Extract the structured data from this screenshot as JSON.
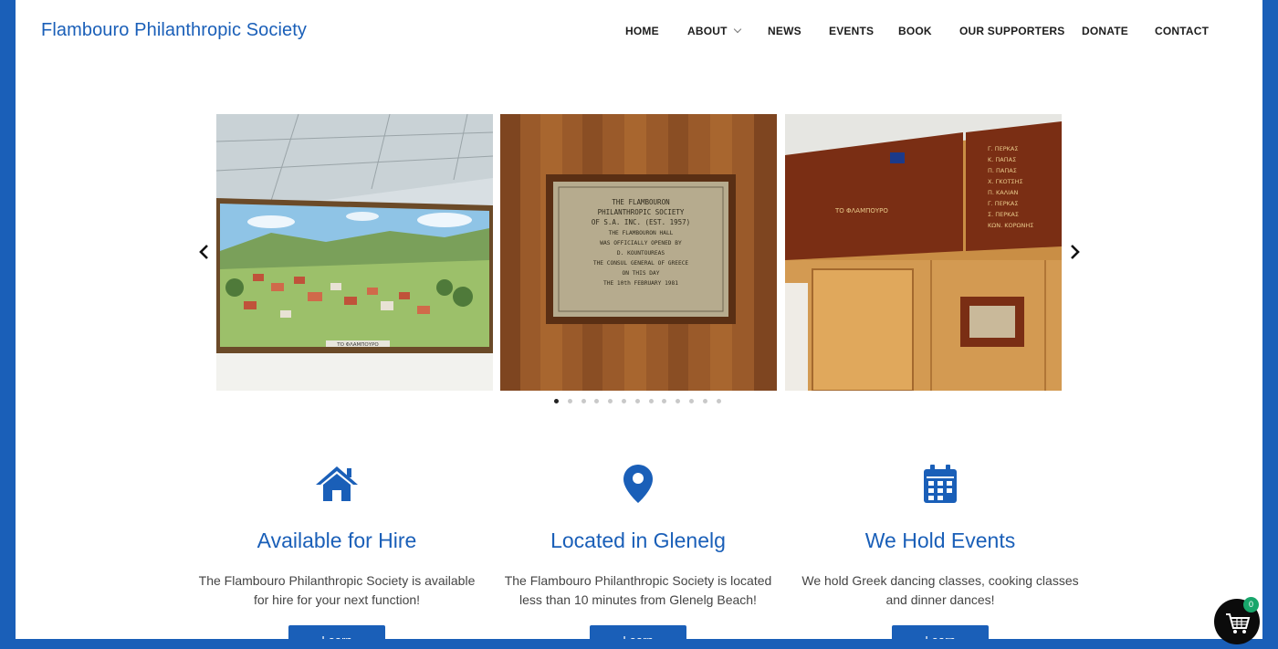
{
  "site": {
    "title": "Flambouro Philanthropic Society"
  },
  "nav": {
    "items": [
      {
        "label": "HOME"
      },
      {
        "label": "ABOUT",
        "has_dropdown": true
      },
      {
        "label": "NEWS"
      },
      {
        "label": "EVENTS"
      },
      {
        "label": "BOOK"
      },
      {
        "label": "OUR SUPPORTERS"
      },
      {
        "label": "DONATE"
      },
      {
        "label": "CONTACT"
      }
    ]
  },
  "slider": {
    "slides": [
      {
        "subject": "village-painting",
        "caption": "ΤΟ ΦΛΑΜΠΟΥΡΟ"
      },
      {
        "subject": "brass-plaque",
        "plaque_lines": [
          "THE FLAMBOURON",
          "PHILANTHROPIC SOCIETY",
          "OF S.A. INC. (EST. 1957)",
          "THE FLAMBOURON HALL",
          "WAS OFFICIALLY OPENED BY",
          "D. KOUNTOUREAS",
          "THE CONSUL GENERAL OF GREECE",
          "ON THIS DAY",
          "THE 10th FEBRUARY 1981"
        ]
      },
      {
        "subject": "honour-board",
        "board_heading": "ΤΟ ΦΛΑΜΠΟΥΡΟ",
        "board_names": [
          "Γ. ΠΕΡΚΑΣ",
          "Κ. ΠΑΠΑΣ",
          "Π. ΠΑΠΑΣ",
          "Χ. ΓΚΟΤΣΗΣ",
          "Π. ΚΑΛΙΑΝ",
          "Γ. ΠΕΡΚΑΣ",
          "Σ. ΠΕΡΚΑΣ",
          "ΚΩΝ. ΚΟΡΩΝΗΣ"
        ]
      }
    ],
    "dot_count": 13,
    "active_dot_index": 0,
    "prev_icon": "chevron-left-icon",
    "next_icon": "chevron-right-icon"
  },
  "features": [
    {
      "icon": "house-icon",
      "title": "Available for Hire",
      "text_line1": "The Flambouro Philanthropic Society is available",
      "text_line2": "for hire for your next function!",
      "button": "Learn More"
    },
    {
      "icon": "map-pin-icon",
      "title": "Located in Glenelg",
      "text_line1": "The Flambouro Philanthropic Society is located",
      "text_line2": "less than 10 minutes from Glenelg Beach!",
      "button": "Learn More"
    },
    {
      "icon": "calendar-icon",
      "title": "We Hold Events",
      "text_line1": "We hold Greek dancing classes, cooking classes",
      "text_line2": "and dinner dances!",
      "button": "Learn More"
    }
  ],
  "cart": {
    "icon": "shopping-cart-icon",
    "count": "0"
  },
  "colors": {
    "brand_blue": "#1a5fb8",
    "text_dark": "#1d1d1d",
    "body_text": "#444444",
    "cart_badge": "#18a66b"
  }
}
